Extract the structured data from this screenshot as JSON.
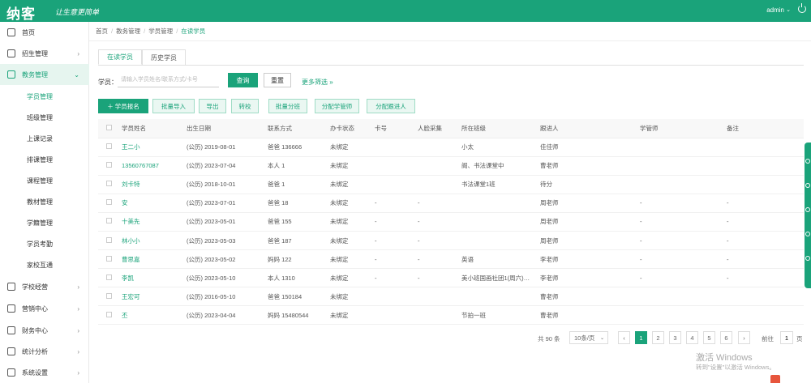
{
  "header": {
    "logo": "纳客",
    "slogan": "让生意更简单",
    "user": "admin",
    "user_caret": "⌄"
  },
  "sidebar": {
    "items": [
      {
        "label": "首页",
        "icon": "home-icon",
        "arrow": ""
      },
      {
        "label": "招生管理",
        "icon": "recruit-icon",
        "arrow": "›"
      },
      {
        "label": "教务管理",
        "icon": "academic-icon",
        "arrow": "⌄",
        "active": true
      },
      {
        "label": "学校经营",
        "icon": "school-icon",
        "arrow": "›"
      },
      {
        "label": "营销中心",
        "icon": "marketing-icon",
        "arrow": "›"
      },
      {
        "label": "财务中心",
        "icon": "finance-icon",
        "arrow": "›"
      },
      {
        "label": "统计分析",
        "icon": "stats-icon",
        "arrow": "›"
      },
      {
        "label": "系统设置",
        "icon": "settings-icon",
        "arrow": "›"
      }
    ],
    "sub_items": [
      {
        "label": "学员管理",
        "active": true
      },
      {
        "label": "班级管理"
      },
      {
        "label": "上课记录"
      },
      {
        "label": "排课管理"
      },
      {
        "label": "课程管理"
      },
      {
        "label": "教材管理"
      },
      {
        "label": "学籍管理"
      },
      {
        "label": "学员考勤"
      },
      {
        "label": "家校互通"
      }
    ]
  },
  "breadcrumb": [
    "首页",
    "教务管理",
    "学员管理",
    "在读学员"
  ],
  "tabs": [
    "在读学员",
    "历史学员"
  ],
  "search": {
    "label": "学员：",
    "placeholder": "请输入学员姓名/联系方式/卡号",
    "query_label": "查询",
    "reset_label": "重置",
    "more_filter": "更多筛选 »"
  },
  "actions": [
    {
      "label": "＋ 学员报名",
      "primary": true
    },
    {
      "label": "批量导入"
    },
    {
      "label": "导出"
    },
    {
      "label": "转校"
    },
    {
      "label": "批量分班"
    },
    {
      "label": "分配学管师"
    },
    {
      "label": "分配跟进人"
    }
  ],
  "table": {
    "headers": [
      "",
      "学员姓名",
      "出生日期",
      "联系方式",
      "办卡状态",
      "卡号",
      "人脸采集",
      "所在班级",
      "跟进人",
      "学管师",
      "备注"
    ],
    "rows": [
      [
        "王二小",
        "(公历) 2019-08-01",
        "爸爸 136666",
        "未绑定",
        "",
        "",
        "小太",
        "佳佳师",
        "",
        ""
      ],
      [
        "13560767087",
        "(公历) 2023-07-04",
        "本人 1",
        "未绑定",
        "",
        "",
        "阁、书法课堂中",
        "曹老师",
        "",
        ""
      ],
      [
        "刘卡特",
        "(公历) 2018-10-01",
        "爸爸 1",
        "未绑定",
        "",
        "",
        "书法课堂1班",
        "待分",
        "",
        ""
      ],
      [
        "安",
        "(公历) 2023-07-01",
        "爸爸 18",
        "未绑定",
        "-",
        "-",
        "",
        "周老师",
        "-",
        "-"
      ],
      [
        "十美先",
        "(公历) 2023-05-01",
        "爸爸 155",
        "未绑定",
        "-",
        "-",
        "",
        "周老师",
        "-",
        "-"
      ],
      [
        "林小小",
        "(公历) 2023-05-03",
        "爸爸 187",
        "未绑定",
        "-",
        "-",
        "",
        "周老师",
        "-",
        "-"
      ],
      [
        "曹思嘉",
        "(公历) 2023-05-02",
        "妈妈 122",
        "未绑定",
        "-",
        "-",
        "英语",
        "李老师",
        "-",
        "-"
      ],
      [
        "李凯",
        "(公历) 2023-05-10",
        "本人 1310",
        "未绑定",
        "-",
        "-",
        "美小班国画社团1(周六)…",
        "李老师",
        "-",
        "-"
      ],
      [
        "王宏可",
        "(公历) 2016-05-10",
        "爸爸 150184",
        "未绑定",
        "",
        "",
        "",
        "曹老师",
        "",
        ""
      ],
      [
        "丕",
        "(公历) 2023-04-04",
        "妈妈 15480544",
        "未绑定",
        "",
        "",
        "节拍一班",
        "曹老师",
        "",
        ""
      ]
    ]
  },
  "pagination": {
    "total": "共 90 条",
    "page_size": "10条/页",
    "page_size_caret": "⌄",
    "prev": "‹",
    "next": "›",
    "pages": [
      "1",
      "2",
      "3",
      "4",
      "5",
      "6"
    ],
    "current": "1",
    "goto_label": "前往",
    "goto_value": "1",
    "page_suffix": "页"
  },
  "watermark": {
    "title": "激活 Windows",
    "subtitle": "转到\"设置\"以激活 Windows。"
  },
  "colors": {
    "accent": "#1aa37a",
    "accent_light": "#eaf7f2"
  }
}
